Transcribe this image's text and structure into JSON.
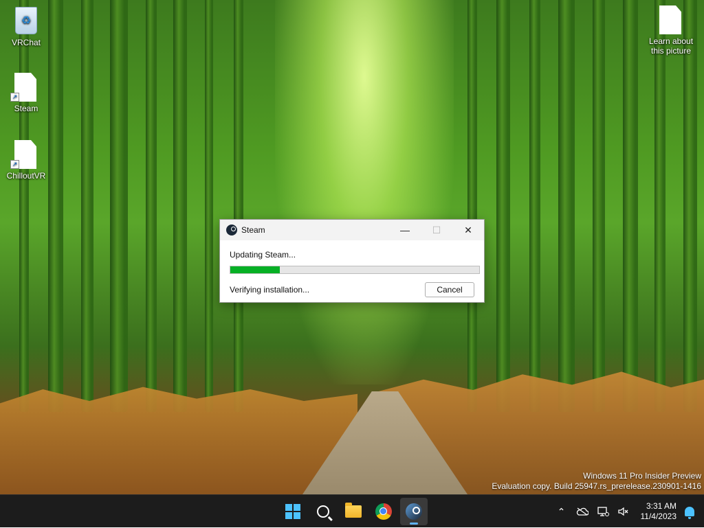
{
  "desktop": {
    "icons": [
      {
        "label": "VRChat",
        "icon": "recycle-bin-icon"
      },
      {
        "label": "Steam",
        "icon": "file-shortcut-icon"
      },
      {
        "label": "ChilloutVR",
        "icon": "file-shortcut-icon"
      },
      {
        "label": "Learn about\nthis picture",
        "icon": "file-icon"
      }
    ],
    "watermark": {
      "line1": "Windows 11 Pro Insider Preview",
      "line2": "Evaluation copy. Build 25947.rs_prerelease.230901-1416"
    }
  },
  "dialog": {
    "title": "Steam",
    "status": "Updating Steam...",
    "progress_fraction": 0.2,
    "substatus": "Verifying installation...",
    "cancel_label": "Cancel",
    "minimize_glyph": "—",
    "maximize_glyph": "☐",
    "close_glyph": "✕",
    "progress_color": "#06b025"
  },
  "taskbar": {
    "apps": [
      {
        "name": "start-button",
        "icon": "windows-logo-icon"
      },
      {
        "name": "search-button",
        "icon": "search-icon"
      },
      {
        "name": "file-explorer",
        "icon": "folder-icon"
      },
      {
        "name": "chrome",
        "icon": "chrome-icon"
      },
      {
        "name": "steam",
        "icon": "steam-icon",
        "active": true
      }
    ],
    "tray": {
      "chevron": "⌃",
      "time": "3:31 AM",
      "date": "11/4/2023"
    },
    "accent_color": "#4cc2ff"
  }
}
